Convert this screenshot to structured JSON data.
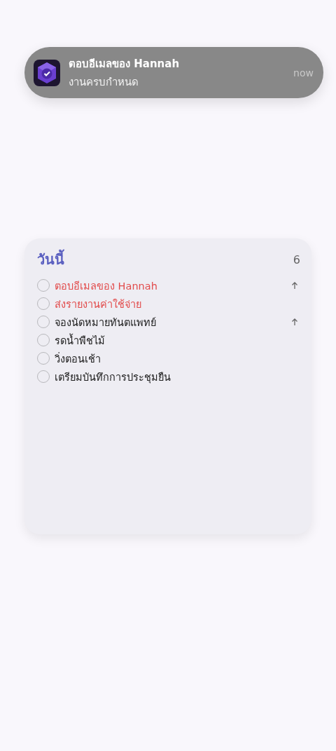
{
  "notification": {
    "title": "ตอบอีเมลของ Hannah",
    "body": "งานครบกำหนด",
    "time": "now"
  },
  "widget": {
    "title": "วันนี้",
    "count": "6",
    "tasks": [
      {
        "label": "ตอบอีเมลของ Hannah",
        "overdue": true,
        "priority": true,
        "checked": false
      },
      {
        "label": "ส่งรายงานค่าใช้จ่าย",
        "overdue": true,
        "priority": false,
        "checked": false
      },
      {
        "label": "จองนัดหมายทันตแพทย์",
        "overdue": false,
        "priority": true,
        "checked": false
      },
      {
        "label": "รดน้ำพืชไม้",
        "overdue": false,
        "priority": false,
        "checked": false
      },
      {
        "label": "วิ่งตอนเช้า",
        "overdue": false,
        "priority": false,
        "checked": false
      },
      {
        "label": "เตรียมบันทึกการประชุมยืน",
        "overdue": false,
        "priority": false,
        "checked": false
      }
    ]
  }
}
